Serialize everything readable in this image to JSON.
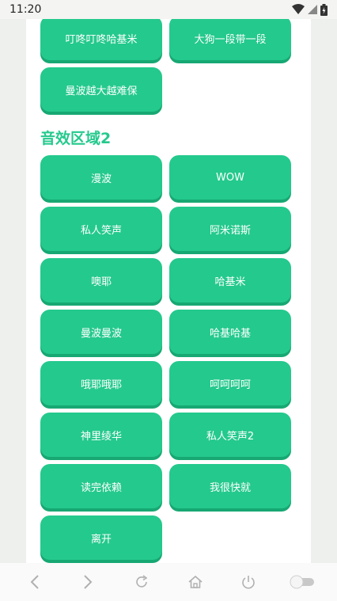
{
  "status": {
    "time": "11:20"
  },
  "section1": {
    "buttons": [
      "叮咚叮咚哈基米",
      "大狗一段带一段",
      "曼波越大越难保"
    ]
  },
  "section2": {
    "title": "音效区域2",
    "buttons": [
      "漫波",
      "WOW",
      "私人笑声",
      "阿米诺斯",
      "噢耶",
      "哈基米",
      "曼波曼波",
      "哈基哈基",
      "哦耶哦耶",
      "呵呵呵呵",
      "神里绫华",
      "私人笑声2",
      "读完依赖",
      "我很快就",
      "离开"
    ]
  },
  "nav": {
    "icons": [
      "back-icon",
      "forward-icon",
      "refresh-icon",
      "home-icon",
      "power-icon",
      "toggle-icon"
    ]
  },
  "colors": {
    "accent": "#24c98d",
    "accent_shadow": "#17a873"
  }
}
